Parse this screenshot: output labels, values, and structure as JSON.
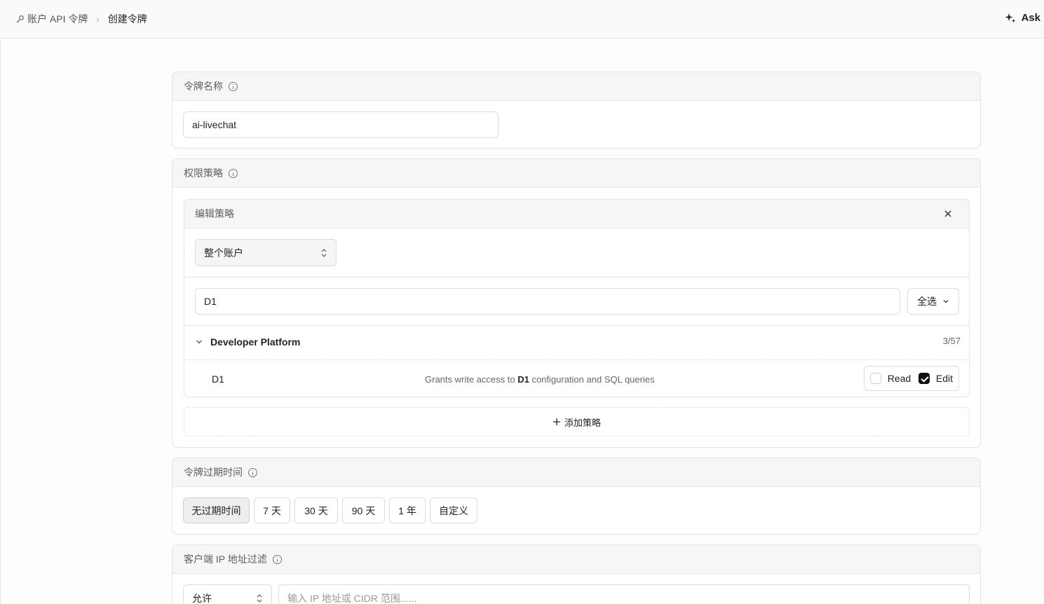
{
  "breadcrumb": {
    "parent": "账户 API 令牌",
    "current": "创建令牌"
  },
  "header": {
    "ask_label": "Ask"
  },
  "token_name": {
    "label": "令牌名称",
    "value": "ai-livechat"
  },
  "permissions": {
    "label": "权限策略",
    "edit_title": "编辑策略",
    "scope_value": "整个账户",
    "search_value": "D1",
    "select_all_label": "全选",
    "group": {
      "title": "Developer Platform",
      "count": "3/57"
    },
    "item": {
      "name": "D1",
      "desc_prefix": "Grants write access to ",
      "desc_bold": "D1",
      "desc_suffix": " configuration and SQL queries",
      "read_label": "Read",
      "read_checked": false,
      "edit_label": "Edit",
      "edit_checked": true
    },
    "add_policy_label": "添加策略"
  },
  "expiry": {
    "label": "令牌过期时间",
    "options": [
      "无过期时间",
      "7 天",
      "30 天",
      "90 天",
      "1 年",
      "自定义"
    ],
    "selected": "无过期时间"
  },
  "ip_filter": {
    "label": "客户端 IP 地址过滤",
    "mode_value": "允许",
    "ip_placeholder": "输入 IP 地址或 CIDR 范围......"
  }
}
